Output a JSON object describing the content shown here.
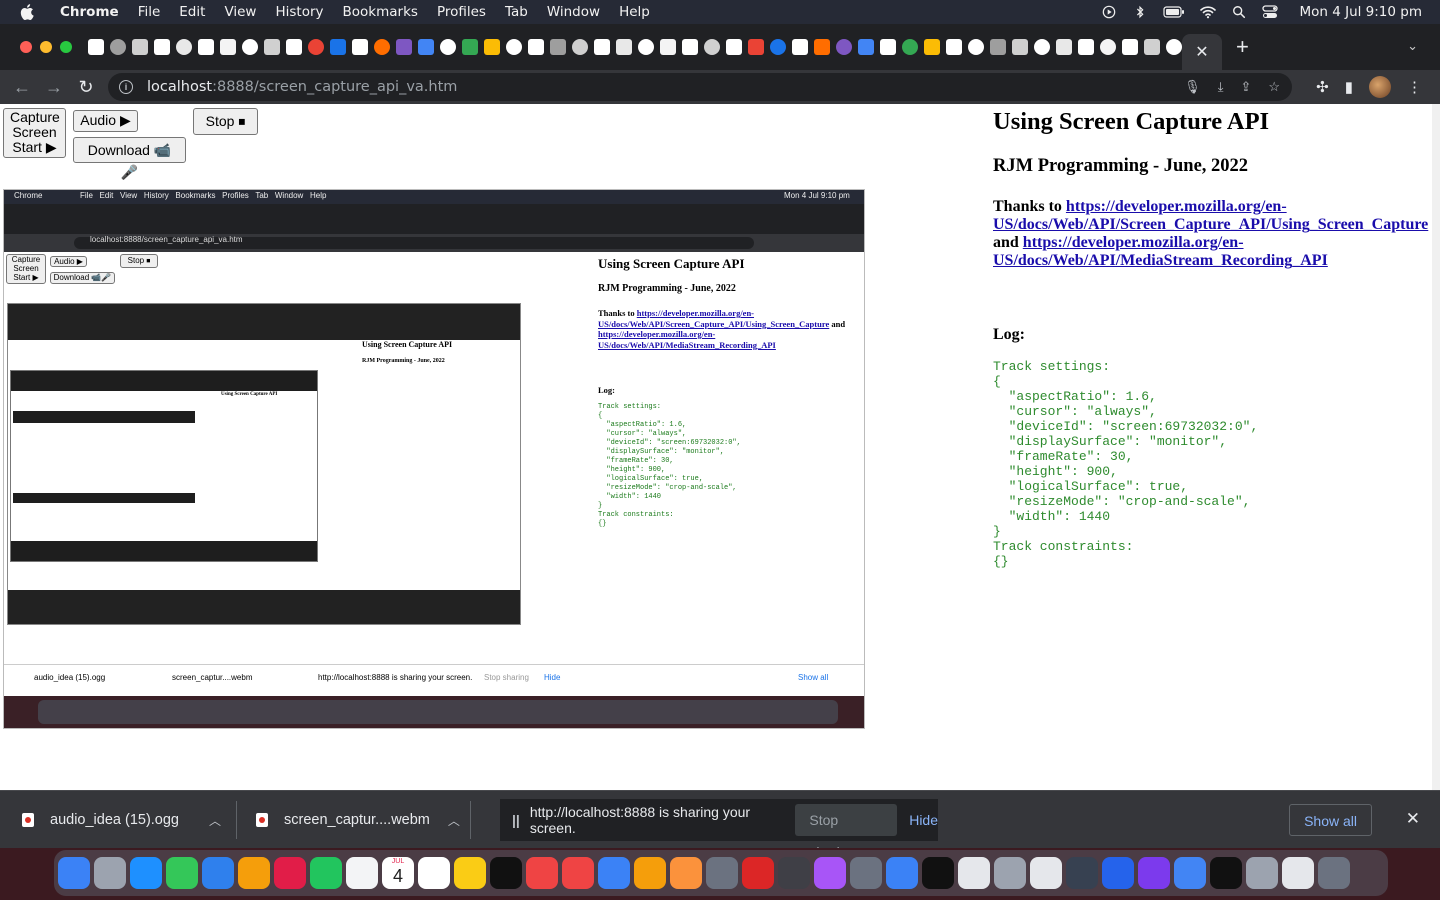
{
  "menubar": {
    "app": "Chrome",
    "items": [
      "File",
      "Edit",
      "View",
      "History",
      "Bookmarks",
      "Profiles",
      "Tab",
      "Window",
      "Help"
    ],
    "clock": "Mon 4 Jul  9:10 pm"
  },
  "browser": {
    "url_host": "localhost",
    "url_path": ":8888/screen_capture_api_va.htm",
    "active_tab_close": "✕",
    "new_tab": "+",
    "tab_search": "⌄"
  },
  "controls": {
    "capture_label": "Capture Screen Start ▶",
    "audio_label": "Audio ▶",
    "stop_label": "Stop ⏹",
    "download_label": "Download 📹🎤"
  },
  "content": {
    "title": "Using Screen Capture API",
    "subtitle": "RJM Programming - June, 2022",
    "thanks_prefix": "Thanks to ",
    "link1": "https://developer.mozilla.org/en-US/docs/Web/API/Screen_Capture_API/Using_Screen_Capture",
    "and_text": " and ",
    "link2": "https://developer.mozilla.org/en-US/docs/Web/API/MediaStream_Recording_API ",
    "log_heading": "Log:",
    "log_text": "Track settings:\n{\n  \"aspectRatio\": 1.6,\n  \"cursor\": \"always\",\n  \"deviceId\": \"screen:69732032:0\",\n  \"displaySurface\": \"monitor\",\n  \"frameRate\": 30,\n  \"height\": 900,\n  \"logicalSurface\": true,\n  \"resizeMode\": \"crop-and-scale\",\n  \"width\": 1440\n}\nTrack constraints:\n{}"
  },
  "preview": {
    "menubar_app": "Chrome",
    "menubar_items": "File   Edit   View   History   Bookmarks   Profiles   Tab   Window   Help",
    "clock": "Mon 4 Jul  9:10 pm",
    "url": "localhost:8888/screen_capture_api_va.htm",
    "dl1": "audio_idea (15).ogg",
    "dl2": "screen_captur....webm",
    "share_text": "http://localhost:8888 is sharing your screen.",
    "stop_sharing": "Stop sharing",
    "hide": "Hide",
    "show_all": "Show all"
  },
  "shelf": {
    "download1": "audio_idea (15).ogg",
    "download2": "screen_captur....webm",
    "share_text": "http://localhost:8888 is sharing your screen.",
    "stop_sharing": "Stop sharing",
    "hide": "Hide",
    "show_all": "Show all",
    "close": "✕"
  },
  "dock": {
    "calendar_day": "4",
    "calendar_month": "JUL"
  }
}
